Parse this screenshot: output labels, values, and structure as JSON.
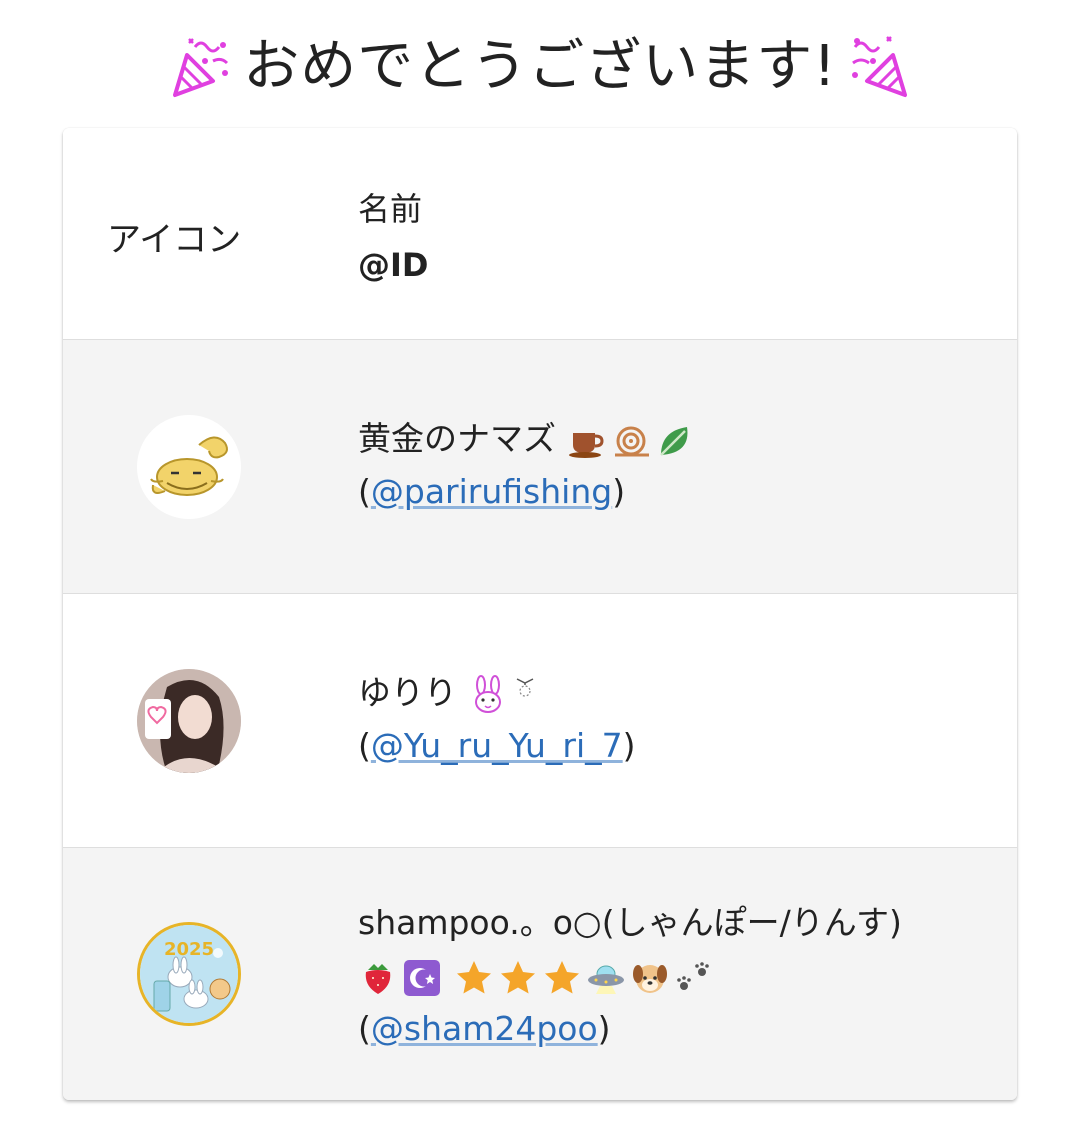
{
  "title": {
    "text": "おめでとうございます!",
    "left_icon": "party-popper-icon",
    "right_icon": "party-popper-icon",
    "accent": "#e040e0"
  },
  "table": {
    "headers": {
      "icon": "アイコン",
      "name": "名前",
      "id": "@ID"
    },
    "rows": [
      {
        "name": "黄金のナマズ",
        "name_emoji": [
          "coffee-cup-icon",
          "snail-icon",
          "leafy-green-icon"
        ],
        "open_paren": "(",
        "handle": "@parirufishing",
        "close_paren": ")",
        "avatar": "golden-catfish-avatar"
      },
      {
        "name": "ゆりり",
        "name_emoji": [
          "rabbit-face-icon",
          "ribbon-sparkle-icon"
        ],
        "open_paren": "(",
        "handle": "@Yu_ru_Yu_ri_7",
        "close_paren": ")",
        "avatar": "girl-photo-avatar"
      },
      {
        "name": "shampoo.。o○(しゃんぽー/りんす)",
        "name_emoji": [
          "strawberry-icon",
          "star-and-crescent-icon",
          "star-icon",
          "star-icon",
          "star-icon",
          "ufo-icon",
          "dog-face-icon",
          "paw-prints-icon"
        ],
        "open_paren": "(",
        "handle": "@sham24poo",
        "close_paren": ")",
        "avatar": "rabbits-2025-avatar"
      }
    ]
  },
  "colors": {
    "link": "#2b6cb8",
    "row_alt": "#f4f4f4",
    "text": "#222222"
  }
}
